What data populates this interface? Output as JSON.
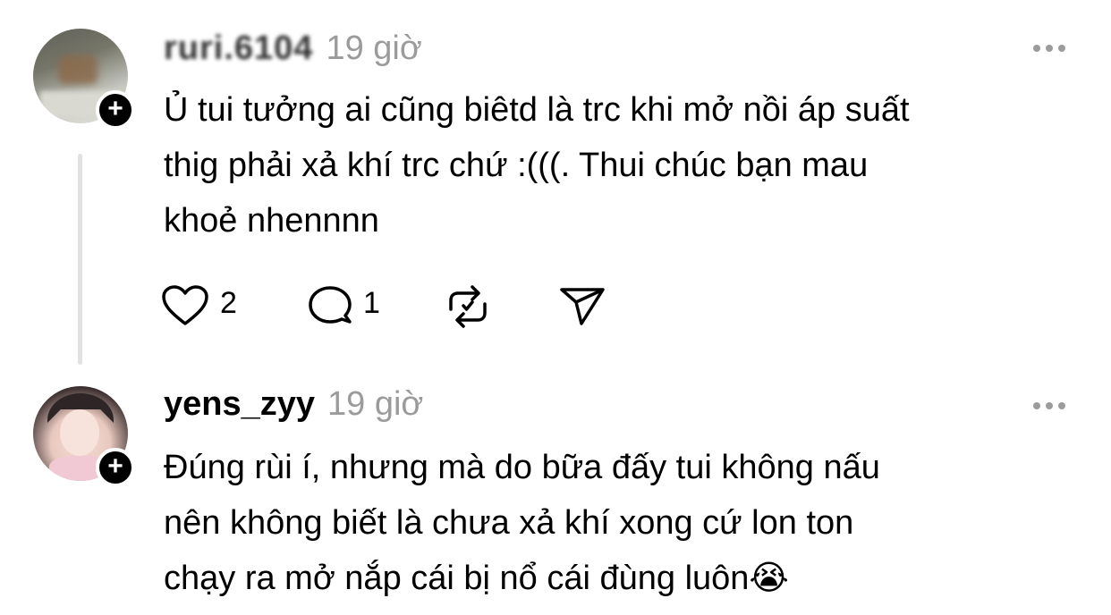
{
  "posts": [
    {
      "username": "ruri.6104",
      "time": "19 giờ",
      "text_lines": [
        "Ủ tui tưởng ai cũng biêtd là trc khi mở nồi áp suất",
        "thig phải xả khí trc chứ :(((. Thui chúc bạn mau",
        "khoẻ nhennnn"
      ],
      "likes": "2",
      "replies": "1"
    },
    {
      "username": "yens_zyy",
      "time": "19 giờ",
      "text_lines": [
        "Đúng rùi í, nhưng mà do bữa đấy tui không nấu",
        "nên không biết là chưa xả khí xong cứ lon ton",
        "chạy ra mở nắp cái bị nổ cái đùng luôn😭"
      ]
    }
  ],
  "icons": {
    "follow": "+",
    "like": "heart-icon",
    "reply": "comment-icon",
    "repost": "repost-icon",
    "share": "send-icon",
    "more": "more-dots-icon"
  },
  "colors": {
    "text": "#000000",
    "secondary": "#9b9b9b",
    "thread_line": "#e1e1e1"
  }
}
